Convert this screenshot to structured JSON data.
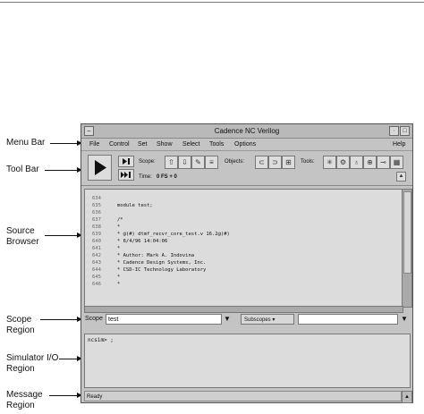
{
  "annotations": {
    "menu_bar": "Menu Bar",
    "tool_bar": "Tool Bar",
    "source_browser": [
      "Source",
      "Browser"
    ],
    "scope_region": [
      "Scope",
      "Region"
    ],
    "simulator_io_region": [
      "Simulator I/O",
      "Region"
    ],
    "message_region": [
      "Message",
      "Region"
    ]
  },
  "window": {
    "title": "Cadence NC Verilog",
    "menu": [
      "File",
      "Control",
      "Set",
      "Show",
      "Select",
      "Tools",
      "Options"
    ],
    "help": "Help"
  },
  "toolbar": {
    "scope_label": "Scope:",
    "objects_label": "Objects:",
    "tools_label": "Tools:",
    "time_label": "Time:",
    "time_value": "0 FS + 0"
  },
  "source": {
    "lines": [
      {
        "num": "",
        "code": ""
      },
      {
        "num": "634",
        "code": ""
      },
      {
        "num": "635",
        "code": "module test;"
      },
      {
        "num": "636",
        "code": ""
      },
      {
        "num": "637",
        "code": "/*"
      },
      {
        "num": "638",
        "code": " *"
      },
      {
        "num": "639",
        "code": " *  @(#) dtmf_recvr_core_test.v 16.2@(#)"
      },
      {
        "num": "640",
        "code": " *  6/4/96  14:04:06"
      },
      {
        "num": "641",
        "code": " *"
      },
      {
        "num": "642",
        "code": " *  Author: Mark A. Indovina"
      },
      {
        "num": "643",
        "code": " *          Cadence Design Systems, Inc."
      },
      {
        "num": "644",
        "code": " *          CSD-IC Technology Laboratory"
      },
      {
        "num": "645",
        "code": " *"
      },
      {
        "num": "646",
        "code": " *"
      }
    ]
  },
  "scope_region": {
    "label": "Scope",
    "value": "test",
    "subscopes": "Subscopes"
  },
  "io": {
    "prompt": "ncsim> ;"
  },
  "status": {
    "text": "Ready"
  }
}
